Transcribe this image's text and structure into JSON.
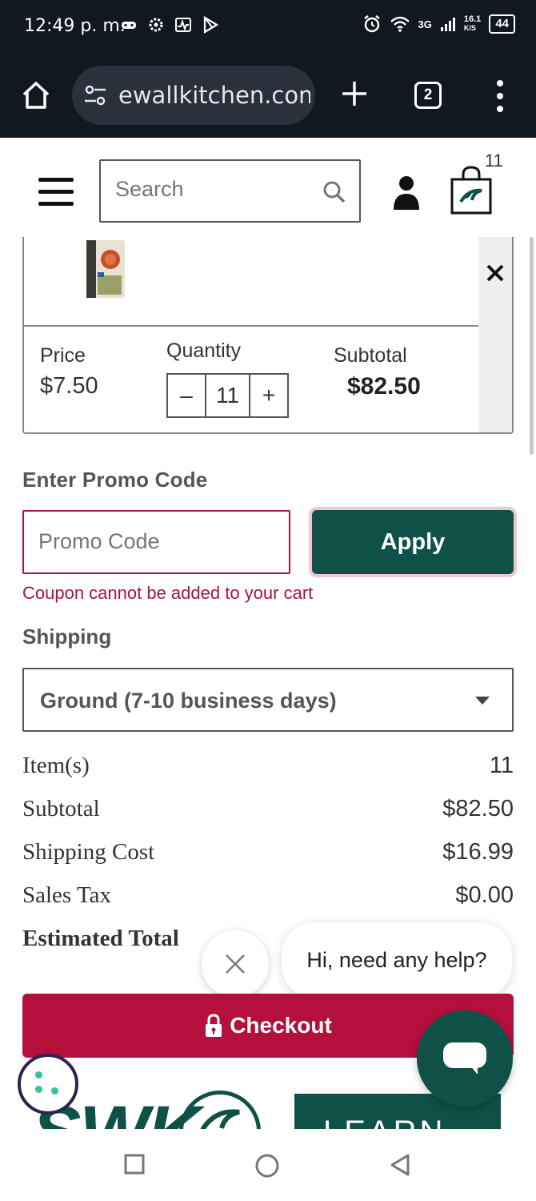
{
  "status_bar": {
    "time": "12:49 p. m.",
    "network": "3G",
    "speed": "16.1",
    "speed_unit": "K/S",
    "battery": "44"
  },
  "browser": {
    "url": "ewallkitchen.com",
    "tab_count": "2"
  },
  "header": {
    "search_placeholder": "Search",
    "cart_count": "11"
  },
  "cart_item": {
    "price_label": "Price",
    "price": "$7.50",
    "quantity_label": "Quantity",
    "minus": "–",
    "quantity": "11",
    "plus": "+",
    "subtotal_label": "Subtotal",
    "subtotal": "$82.50",
    "remove": "×"
  },
  "promo": {
    "label": "Enter Promo Code",
    "placeholder": "Promo Code",
    "apply_label": "Apply",
    "error": "Coupon cannot be added to your cart"
  },
  "shipping": {
    "label": "Shipping",
    "selected": "Ground (7-10 business days)"
  },
  "summary": [
    {
      "label": "Item(s)",
      "value": "11"
    },
    {
      "label": "Subtotal",
      "value": "$82.50"
    },
    {
      "label": "Shipping Cost",
      "value": "$16.99"
    },
    {
      "label": "Sales Tax",
      "value": "$0.00"
    },
    {
      "label": "Estimated Total",
      "value": ""
    }
  ],
  "chat": {
    "greeting": "Hi, need any help?"
  },
  "checkout": {
    "label": "Checkout"
  },
  "footer": {
    "logo": "SWK",
    "banner": "LEARN"
  },
  "colors": {
    "brand_green": "#0f5146",
    "brand_red": "#b50f3c",
    "error_red": "#a8143c"
  }
}
